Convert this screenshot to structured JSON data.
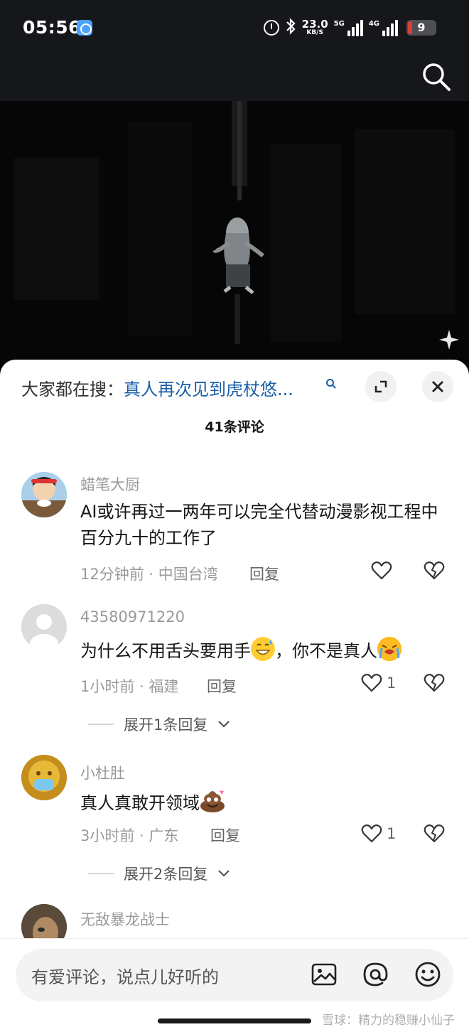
{
  "status_bar": {
    "time": "05:56",
    "net_speed": "23.0",
    "net_speed_unit": "KB/S",
    "net1_label": "5G",
    "net2_label": "4G",
    "battery_level": "9",
    "battery_color": "#e23b3b"
  },
  "icons": {
    "search": "search-icon",
    "alarm": "alarm-icon",
    "bluetooth": "bluetooth-icon",
    "expand": "expand-icon",
    "close": "close-icon",
    "like": "heart-icon",
    "dislike": "broken-heart-icon",
    "image": "image-icon",
    "mention": "at-icon",
    "emoji": "emoji-icon"
  },
  "sheet": {
    "hot_search_prefix": "大家都在搜：",
    "hot_search_query": "真人再次见到虎杖悠...",
    "comment_count_label": "41条评论"
  },
  "comments": [
    {
      "username": "蜡笔大厨",
      "text": "AI或许再过一两年可以完全代替动漫影视工程中百分九十的工作了",
      "time": "12分钟前",
      "location": "中国台湾",
      "reply_label": "回复",
      "likes": ""
    },
    {
      "username": "43580971220",
      "text_before_emoji": "为什么不用舌头要用手",
      "text_after_emoji": "，你不是真人",
      "time": "1小时前",
      "location": "福建",
      "reply_label": "回复",
      "likes": "1",
      "expand_label": "展开1条回复"
    },
    {
      "username": "小杜肚",
      "text": "真人真敢开领域",
      "time": "3小时前",
      "location": "广东",
      "reply_label": "回复",
      "likes": "1",
      "expand_label": "展开2条回复"
    },
    {
      "username": "无敌暴龙战士"
    }
  ],
  "input": {
    "placeholder": "有爱评论，说点儿好听的"
  },
  "watermark": "雪球：精力的稳赚小仙子",
  "colors": {
    "accent_link": "#1b5fa6",
    "dark_bar": "#16171b"
  }
}
